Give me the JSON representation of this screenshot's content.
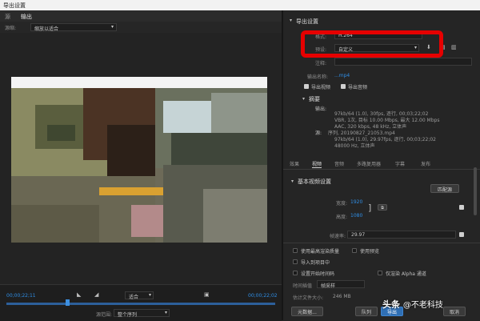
{
  "window": {
    "title": "导出设置"
  },
  "left": {
    "tabs": [
      {
        "label": "源"
      },
      {
        "label": "输出"
      }
    ],
    "source_scaling": {
      "label": "源缩:",
      "value": "缩放以适合"
    },
    "timeline": {
      "start_tc": "00;00;22;11",
      "end_tc": "00;00;22;02",
      "fit_label": "适合",
      "range_label": "源范围:",
      "range_value": "整个序列"
    }
  },
  "right": {
    "export_settings_header": "导出设置",
    "format": {
      "label": "格式:",
      "value": "H.264"
    },
    "preset": {
      "label": "预设:",
      "value": "自定义"
    },
    "comments": {
      "label": "注释:"
    },
    "output_name": {
      "label": "输出名称:",
      "value": "...mp4"
    },
    "export_video": "导出视频",
    "export_audio": "导出音频",
    "summary": {
      "header": "摘要",
      "output_label": "输出:",
      "output_line1": "97kb/64 (1.0), 30fps, 逐行, 00;03;22;02",
      "output_line2": "VBR, 1次, 目标 10.00 Mbps, 最大 12.00 Mbps",
      "output_line3": "AAC, 320 kbps, 48 kHz, 立体声",
      "source_label": "源:",
      "source_name": "序列, 20190827_21053.mp4",
      "source_line1": "97kb/64 (1.0), 29.97fps, 逐行, 00;03;22;02",
      "source_line2": "48000 Hz, 立体声"
    },
    "tabs": [
      {
        "label": "效果"
      },
      {
        "label": "视频"
      },
      {
        "label": "音频"
      },
      {
        "label": "多路复用器"
      },
      {
        "label": "字幕"
      },
      {
        "label": "发布"
      }
    ],
    "basic_video": {
      "header": "基本视频设置",
      "match_source_button": "匹配源",
      "width_label": "宽度:",
      "width_value": "1920",
      "height_label": "高度:",
      "height_value": "1080",
      "fps_label": "帧速率:",
      "fps_value": "29.97"
    },
    "options": {
      "max_render_quality": "使用最高渲染质量",
      "use_previews": "使用预览",
      "import_into_project": "导入到项目中",
      "set_start_timecode": "设置开始时间码",
      "render_alpha": "仅渲染 Alpha 通道",
      "time_interp_label": "时间插值",
      "time_interp_value": "帧采样",
      "file_size_label": "估计文件大小:",
      "file_size_value": "246 MB"
    },
    "buttons": {
      "metadata": "元数据...",
      "queue": "队列",
      "export": "导出",
      "cancel": "取消"
    }
  },
  "watermark": {
    "prefix": "头条 ",
    "handle": "@不老科技"
  },
  "colors": {
    "accent_blue": "#2f8ee6",
    "highlight_red": "#e60000",
    "panel_bg": "#232323"
  }
}
